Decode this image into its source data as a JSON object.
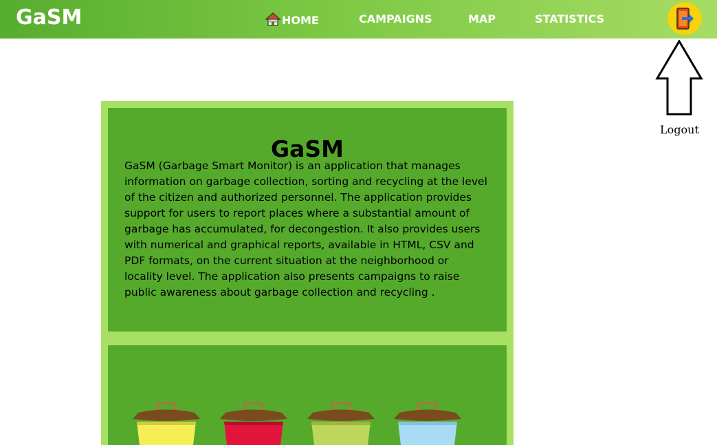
{
  "header": {
    "brand": "GaSM",
    "nav": [
      {
        "label": "HOME",
        "icon": "home-icon"
      },
      {
        "label": "CAMPAIGNS"
      },
      {
        "label": "MAP"
      },
      {
        "label": "STATISTICS"
      }
    ],
    "logout_icon": "logout-door-icon"
  },
  "annotation": {
    "label": "Logout"
  },
  "info": {
    "title": "GaSM",
    "description": "GaSM (Garbage Smart Monitor) is an application that manages information on garbage collection, sorting and recycling at the level of the citizen and authorized personnel. The application provides support for users to report places where a substantial amount of garbage has accumulated, for decongestion. It also provides users with numerical and graphical reports, available in HTML, CSV and PDF formats, on the current situation at the neighborhood or locality level. The application also presents campaigns to raise public awareness about garbage collection and recycling ."
  },
  "bins": [
    {
      "name": "yellow-bin",
      "color": "#f7ee55"
    },
    {
      "name": "red-bin",
      "color": "#e2143c"
    },
    {
      "name": "olive-bin",
      "color": "#bfd65c"
    },
    {
      "name": "blue-bin",
      "color": "#a8dcf4"
    }
  ],
  "colors": {
    "navbar_start": "#57ad2f",
    "navbar_end": "#a6dc63",
    "panel_border": "#a8e064",
    "panel_fill": "#55aa2c",
    "logout_button": "#f6d30c",
    "bin_lid": "#7a4b1e"
  }
}
